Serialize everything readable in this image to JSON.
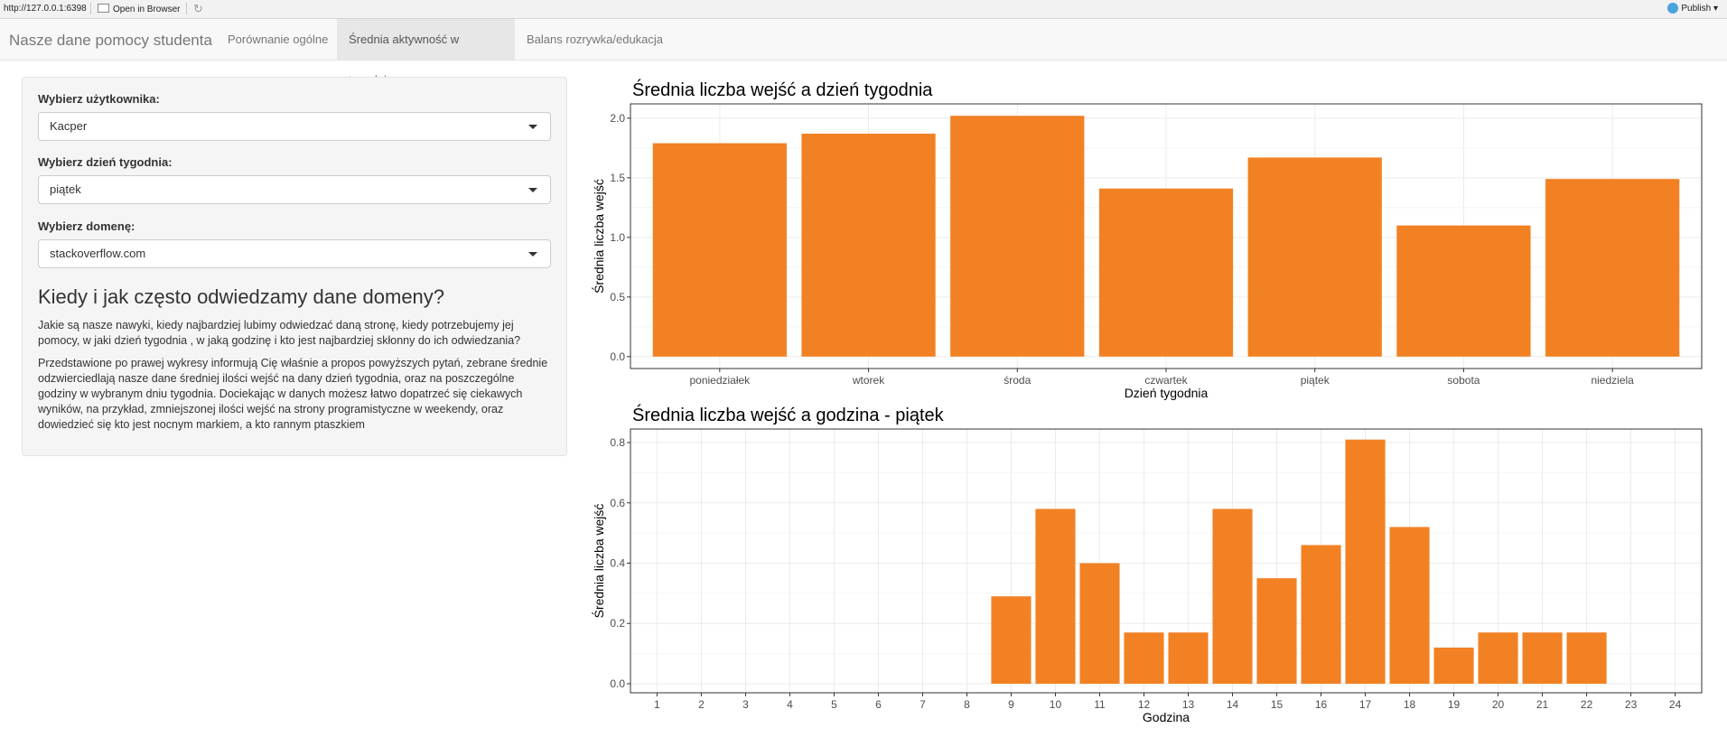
{
  "topbar": {
    "url": "http://127.0.0.1:6398",
    "open_in_browser": "Open in Browser",
    "publish": "Publish"
  },
  "navbar": {
    "brand": "Nasze dane pomocy studenta",
    "tabs": [
      {
        "label": "Porównanie ogólne",
        "active": false
      },
      {
        "label": "Średnia aktywność w tygodniu",
        "active": true
      },
      {
        "label": "Balans rozrywka/edukacja",
        "active": false
      }
    ]
  },
  "sidebar": {
    "user_label": "Wybierz użytkownika:",
    "user_value": "Kacper",
    "day_label": "Wybierz dzień tygodnia:",
    "day_value": "piątek",
    "domain_label": "Wybierz domenę:",
    "domain_value": "stackoverflow.com",
    "heading": "Kiedy i jak często odwiedzamy dane domeny?",
    "paragraph1": "Jakie są nasze nawyki, kiedy najbardziej lubimy odwiedzać daną stronę, kiedy potrzebujemy jej pomocy, w jaki dzień tygodnia , w jaką godzinę i kto jest najbardziej skłonny do ich odwiedzania?",
    "paragraph2": "Przedstawione po prawej wykresy informują Cię właśnie a propos powyższych pytań, zebrane średnie odzwierciedlają nasze dane średniej ilości wejść na dany dzień tygodnia, oraz na poszczególne godziny w wybranym dniu tygodnia. Dociekając w danych możesz łatwo dopatrzeć się ciekawych wyników, na przykład, zmniejszonej ilości wejść na strony programistyczne w weekendy, oraz dowiedzieć się kto jest nocnym markiem, a kto rannym ptaszkiem"
  },
  "colors": {
    "bar": "#f28123",
    "panel_border": "#333333"
  },
  "chart_data": [
    {
      "type": "bar",
      "title": "Średnia liczba wejść a dzień tygodnia",
      "xlabel": "Dzień tygodnia",
      "ylabel": "Średnia liczba wejść",
      "categories": [
        "poniedziałek",
        "wtorek",
        "środa",
        "czwartek",
        "piątek",
        "sobota",
        "niedziela"
      ],
      "values": [
        1.79,
        1.87,
        2.02,
        1.41,
        1.67,
        1.1,
        1.49
      ],
      "ylim": [
        -0.1,
        2.12
      ],
      "yticks": [
        0.0,
        0.5,
        1.0,
        1.5,
        2.0
      ],
      "ytick_labels": [
        "0.0",
        "0.5",
        "1.0",
        "1.5",
        "2.0"
      ],
      "grid": true
    },
    {
      "type": "bar",
      "title": "Średnia liczba wejść a godzina -  piątek",
      "xlabel": "Godzina",
      "ylabel": "Średnia liczba wejść",
      "categories": [
        "1",
        "2",
        "3",
        "4",
        "5",
        "6",
        "7",
        "8",
        "9",
        "10",
        "11",
        "12",
        "13",
        "14",
        "15",
        "16",
        "17",
        "18",
        "19",
        "20",
        "21",
        "22",
        "23",
        "24"
      ],
      "values": [
        0,
        0,
        0,
        0,
        0,
        0,
        0,
        0,
        0.29,
        0.58,
        0.4,
        0.17,
        0.17,
        0.58,
        0.35,
        0.46,
        0.81,
        0.52,
        0.12,
        0.17,
        0.17,
        0.17,
        0,
        0
      ],
      "ylim": [
        -0.03,
        0.845
      ],
      "yticks": [
        0.0,
        0.2,
        0.4,
        0.6,
        0.8
      ],
      "ytick_labels": [
        "0.0",
        "0.2",
        "0.4",
        "0.6",
        "0.8"
      ],
      "grid": true
    }
  ]
}
